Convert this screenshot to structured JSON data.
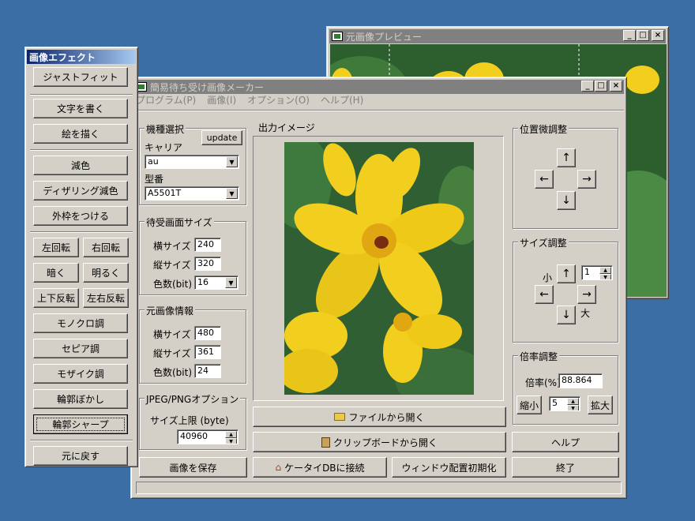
{
  "preview": {
    "title": "元画像プレビュー"
  },
  "effects": {
    "title": "画像エフェクト",
    "buttons": [
      "ジャストフィット",
      "文字を書く",
      "絵を描く",
      "減色",
      "ディザリング減色",
      "外枠をつける",
      "左回転",
      "右回転",
      "暗く",
      "明るく",
      "上下反転",
      "左右反転",
      "モノクロ調",
      "セピア調",
      "モザイク調",
      "輪郭ぼかし",
      "輪郭シャープ",
      "元に戻す"
    ]
  },
  "main": {
    "title": "簡易待ち受け画像メーカー",
    "menu": [
      "プログラム(P)",
      "画像(I)",
      "オプション(O)",
      "ヘルプ(H)"
    ],
    "model": {
      "group": "機種選択",
      "update": "update",
      "carrier_label": "キャリア",
      "carrier": "au",
      "model_label": "型番",
      "model": "A5501T"
    },
    "screen": {
      "group": "待受画面サイズ",
      "w_label": "横サイズ",
      "w": "240",
      "h_label": "縦サイズ",
      "h": "320",
      "c_label": "色数(bit)",
      "c": "16"
    },
    "original": {
      "group": "元画像情報",
      "w_label": "横サイズ",
      "w": "480",
      "h_label": "縦サイズ",
      "h": "361",
      "c_label": "色数(bit)",
      "c": "24"
    },
    "jpeg": {
      "group": "JPEG/PNGオプション",
      "limit_label": "サイズ上限 (byte)",
      "limit": "40960"
    },
    "output_label": "出力イメージ",
    "pos": {
      "group": "位置微調整"
    },
    "size": {
      "group": "サイズ調整",
      "small": "小",
      "large": "大",
      "step": "1"
    },
    "zoom": {
      "group": "倍率調整",
      "label": "倍率(%)",
      "value": "88.864",
      "shrink": "縮小",
      "step": "5",
      "enlarge": "拡大"
    },
    "arrows": {
      "up": "↑",
      "left": "←",
      "right": "→",
      "down": "↓"
    },
    "buttons": {
      "open_file": "ファイルから開く",
      "open_clip": "クリップボードから開く",
      "help": "ヘルプ",
      "save": "画像を保存",
      "connect": "ケータイDBに接続",
      "reset": "ウィンドウ配置初期化",
      "exit": "終了"
    }
  },
  "colors": {
    "desktop": "#3a6ea5",
    "titlebar_active": "#0a246a",
    "face": "#d4d0c8",
    "flower": "#f2cf1f"
  }
}
